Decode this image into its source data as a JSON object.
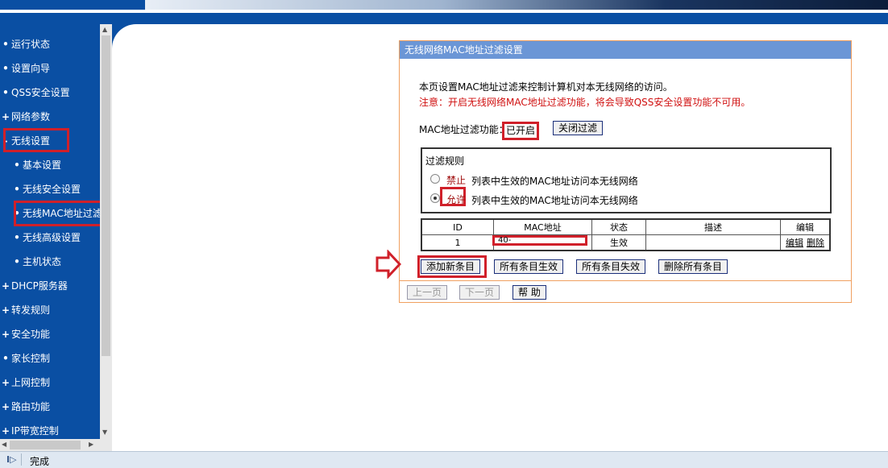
{
  "sidebar": {
    "items": [
      {
        "bullet": "•",
        "label": "运行状态"
      },
      {
        "bullet": "•",
        "label": "设置向导"
      },
      {
        "bullet": "•",
        "label": "QSS安全设置"
      },
      {
        "bullet": "+",
        "label": "网络参数"
      },
      {
        "bullet": "-",
        "label": "无线设置"
      },
      {
        "bullet": "•",
        "label": "基本设置"
      },
      {
        "bullet": "•",
        "label": "无线安全设置"
      },
      {
        "bullet": "•",
        "label": "无线MAC地址过滤"
      },
      {
        "bullet": "•",
        "label": "无线高级设置"
      },
      {
        "bullet": "•",
        "label": "主机状态"
      },
      {
        "bullet": "+",
        "label": "DHCP服务器"
      },
      {
        "bullet": "+",
        "label": "转发规则"
      },
      {
        "bullet": "+",
        "label": "安全功能"
      },
      {
        "bullet": "•",
        "label": "家长控制"
      },
      {
        "bullet": "+",
        "label": "上网控制"
      },
      {
        "bullet": "+",
        "label": "路由功能"
      },
      {
        "bullet": "+",
        "label": "IP带宽控制"
      }
    ]
  },
  "panel": {
    "title": "无线网络MAC地址过滤设置",
    "desc": "本页设置MAC地址过滤来控制计算机对本无线网络的访问。",
    "warning": "注意：开启无线网络MAC地址过滤功能，将会导致QSS安全设置功能不可用。",
    "filter_label": "MAC地址过滤功能：",
    "filter_status": "已开启",
    "close_button": "关闭过滤",
    "rules_title": "过滤规则",
    "rule_deny_label": "禁止",
    "rule_deny_text": "列表中生效的MAC地址访问本无线网络",
    "rule_allow_label": "允许",
    "rule_allow_text": "列表中生效的MAC地址访问本无线网络",
    "selected_rule": "allow"
  },
  "table": {
    "headers": [
      "ID",
      "MAC地址",
      "状态",
      "描述",
      "编辑"
    ],
    "rows": [
      {
        "id": "1",
        "mac": "40-",
        "status": "生效",
        "desc": "",
        "edit": "编辑",
        "delete": "删除"
      }
    ]
  },
  "actions": {
    "add": "添加新条目",
    "enable_all": "所有条目生效",
    "disable_all": "所有条目失效",
    "delete_all": "删除所有条目"
  },
  "footer": {
    "prev": "上一页",
    "next": "下一页",
    "help": "帮 助"
  },
  "status_bar": {
    "text": "完成"
  },
  "colors": {
    "nav": "#0a4fa3",
    "panel_header": "#6b96d6",
    "highlight": "#d0202a",
    "warning": "#d01010"
  }
}
